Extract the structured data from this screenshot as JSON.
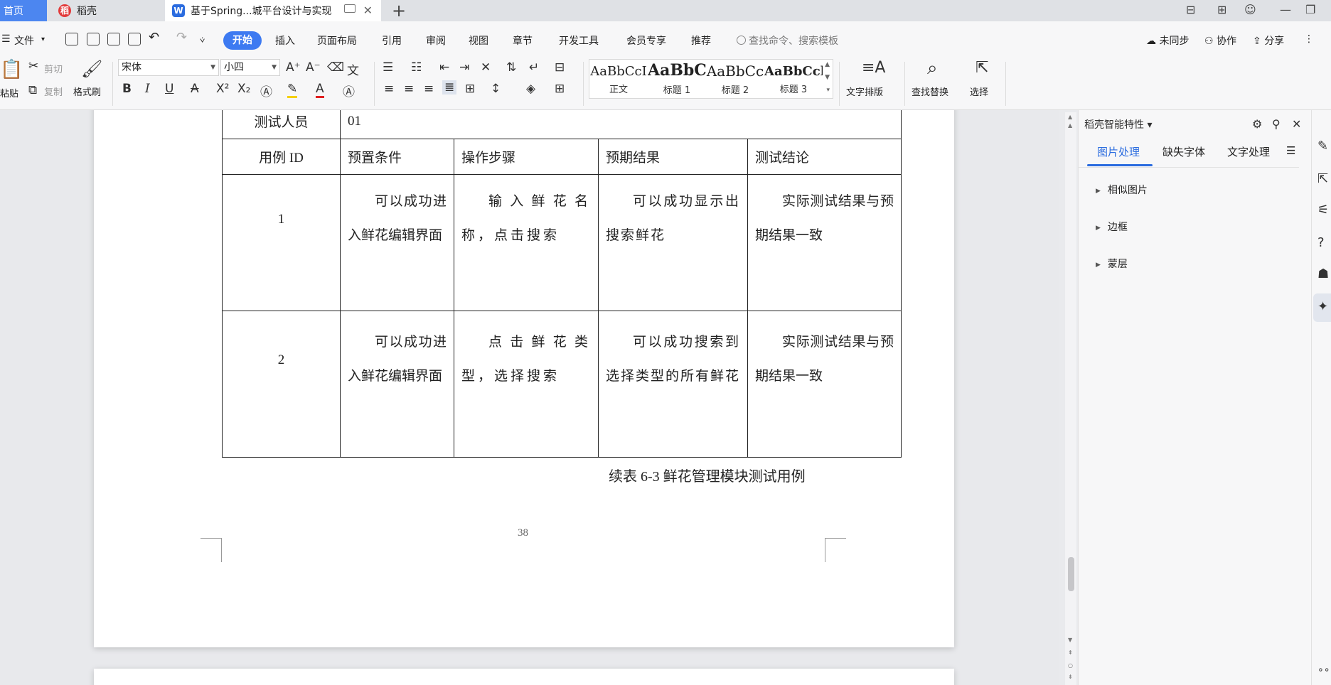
{
  "tabs": {
    "home": "首页",
    "daoke": "稻壳",
    "document": "基于Spring...城平台设计与实现",
    "new_tab": "+"
  },
  "menu": {
    "file": "文件",
    "start": "开始",
    "items": [
      "插入",
      "页面布局",
      "引用",
      "审阅",
      "视图",
      "章节",
      "开发工具",
      "会员专享",
      "推荐"
    ],
    "search_placeholder": "查找命令、搜索模板",
    "sync": "未同步",
    "collab": "协作",
    "share": "分享"
  },
  "ribbon": {
    "paste": "粘贴",
    "cut": "剪切",
    "copy": "复制",
    "format_painter": "格式刷",
    "font_name": "宋体",
    "font_size": "小四",
    "styles": [
      {
        "preview": "AaBbCcI",
        "name": "正文"
      },
      {
        "preview": "AaBbC",
        "name": "标题 1"
      },
      {
        "preview": "AaBbCc",
        "name": "标题 2"
      },
      {
        "preview": "AaBbCcl",
        "name": "标题 3"
      }
    ],
    "text_layout": "文字排版",
    "find_replace": "查找替换",
    "select": "选择"
  },
  "document": {
    "tester_label": "测试人员",
    "tester_value": "01",
    "headers": [
      "用例 ID",
      "预置条件",
      "操作步骤",
      "预期结果",
      "测试结论"
    ],
    "rows": [
      {
        "id": "1",
        "precondition": "可以成功进入鲜花编辑界面",
        "steps": "输入鲜花名称，点击搜索",
        "expected": "可以成功显示出搜索鲜花",
        "conclusion": "实际测试结果与预期结果一致"
      },
      {
        "id": "2",
        "precondition": "可以成功进入鲜花编辑界面",
        "steps": "点击鲜花类型，选择搜索",
        "expected": "可以成功搜索到选择类型的所有鲜花",
        "conclusion": "实际测试结果与预期结果一致"
      }
    ],
    "caption": "续表 6-3  鲜花管理模块测试用例",
    "page_number": "38"
  },
  "side_panel": {
    "title": "稻壳智能特性",
    "tabs": [
      "图片处理",
      "缺失字体",
      "文字处理"
    ],
    "items": [
      "相似图片",
      "边框",
      "蒙层"
    ]
  },
  "colors": {
    "accent": "#3d7af1",
    "home_tab": "#4c86f0"
  }
}
